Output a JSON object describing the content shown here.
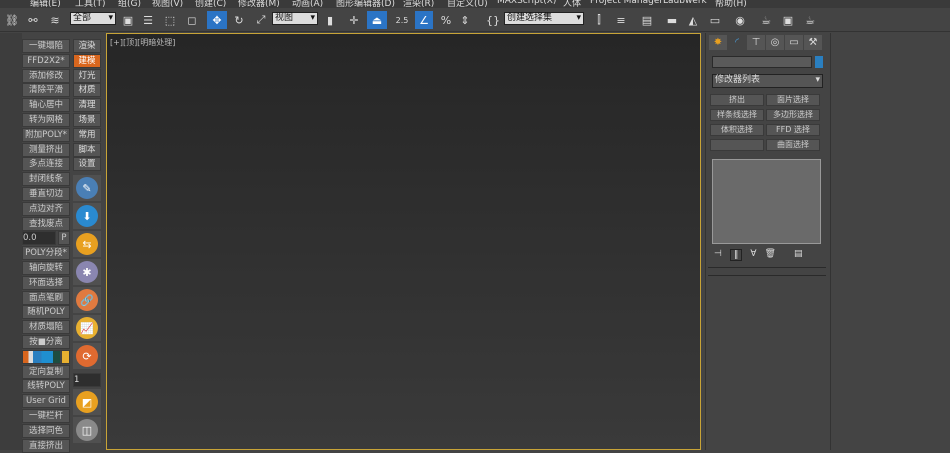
{
  "menu": [
    "编辑(E)",
    "工具(T)",
    "组(G)",
    "视图(V)",
    "创建(C)",
    "修改器(M)",
    "动画(A)",
    "图形编辑器(D)",
    "渲染(R)",
    "自定义(U)",
    "MAXScript(X)",
    "人体",
    "Project Manager",
    "Laubwerk",
    "帮助(H)"
  ],
  "toolbar": {
    "selection_filter": "全部",
    "ref_coord": "视图",
    "snap_angle": "2.5",
    "named_selection": "创建选择集"
  },
  "left_buttons": [
    "一键塌陷",
    "FFD2X2*",
    "添加修改",
    "清除平滑",
    "轴心居中",
    "转为网格",
    "附加POLY*",
    "测量挤出",
    "多点连接",
    "封闭线条",
    "垂直切边",
    "点边对齐",
    "查找废点",
    "0.0",
    "POLY分段*",
    "轴向旋转",
    "环面选择",
    "面点笔刷",
    "随机POLY",
    "材质塌陷",
    "按■分离",
    "",
    "定向复制",
    "线转POLY",
    "User Grid",
    "一键栏杆",
    "选择同色",
    "直接挤出"
  ],
  "spinner_left": {
    "value": "0.0",
    "label": "P"
  },
  "right_tabs": [
    "渲染",
    "建模",
    "灯光",
    "材质",
    "清理",
    "场景",
    "常用",
    "脚本",
    "设置"
  ],
  "right_active": "建模",
  "right_icons": [
    {
      "name": "pen-icon",
      "color": "#4a7fb5"
    },
    {
      "name": "download-icon",
      "color": "#2a8ad0"
    },
    {
      "name": "refresh-arrows-icon",
      "color": "#e8a020"
    },
    {
      "name": "snowflake-icon",
      "color": "#8a86b0"
    },
    {
      "name": "link-icon",
      "color": "#e07a40"
    },
    {
      "name": "graph-icon",
      "color": "#e8b030"
    },
    {
      "name": "cycle-icon",
      "color": "#e06a30"
    },
    {
      "name": "image-icon",
      "color": "#e8a020"
    },
    {
      "name": "box-icon",
      "color": "#8a8a8a"
    }
  ],
  "spinner_right": {
    "value": "1"
  },
  "viewport": {
    "label": "[+][顶][明暗处理]"
  },
  "command_panel": {
    "tabs": [
      "create",
      "modify",
      "hierarchy",
      "motion",
      "display",
      "utilities"
    ],
    "object_name": "",
    "object_color": "#2a7fc0",
    "modifier_list": "修改器列表",
    "modifier_buttons": [
      "挤出",
      "面片选择",
      "样条线选择",
      "多边形选择",
      "体积选择",
      "FFD 选择",
      "",
      "曲面选择"
    ]
  }
}
